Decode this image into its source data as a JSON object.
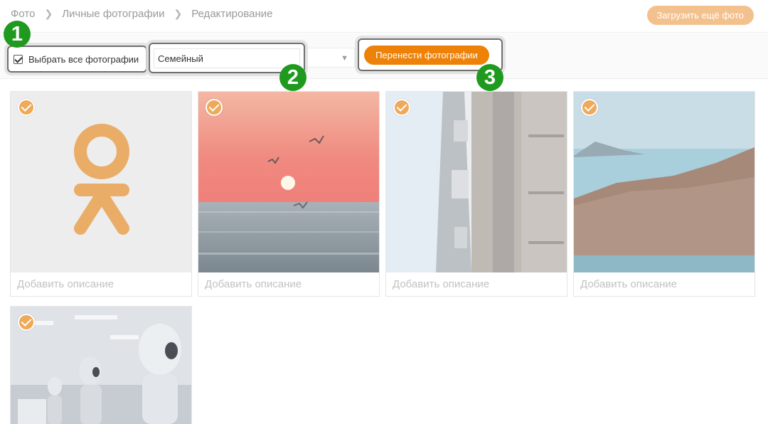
{
  "breadcrumb": {
    "items": [
      "Фото",
      "Личные фотографии",
      "Редактирование"
    ]
  },
  "header": {
    "upload_label": "Загрузить ещё фото"
  },
  "toolbar": {
    "select_all_label": "Выбрать все фотографии",
    "select_all_checked": true,
    "album_selected": "Семейный",
    "move_label": "Перенести фотографии"
  },
  "callouts": [
    "1",
    "2",
    "3"
  ],
  "photos": [
    {
      "subject": "ok-logo",
      "selected": true,
      "description_placeholder": "Добавить описание"
    },
    {
      "subject": "sunset-sea-birds",
      "selected": true,
      "description_placeholder": "Добавить описание"
    },
    {
      "subject": "city-street-tilted",
      "selected": true,
      "description_placeholder": "Добавить описание"
    },
    {
      "subject": "sea-cliffs",
      "selected": true,
      "description_placeholder": "Добавить описание"
    },
    {
      "subject": "robots-office",
      "selected": true,
      "description_placeholder": ""
    }
  ],
  "colors": {
    "accent": "#ee8208",
    "accent_light": "#f3c18e",
    "callout_badge": "#1f9a1f"
  }
}
